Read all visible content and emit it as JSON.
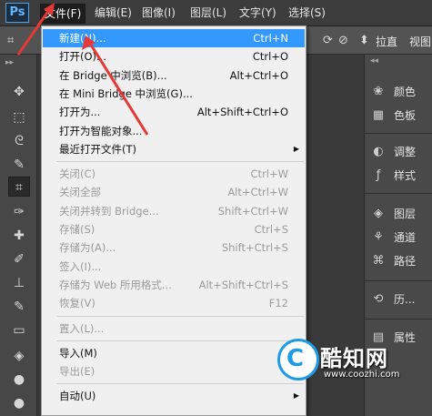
{
  "app": {
    "logo": "Ps"
  },
  "menubar": [
    {
      "label": "文件(F)",
      "active": true
    },
    {
      "label": "编辑(E)"
    },
    {
      "label": "图像(I)"
    },
    {
      "label": "图层(L)"
    },
    {
      "label": "文字(Y)"
    },
    {
      "label": "选择(S)"
    }
  ],
  "options": {
    "pull_label": "拉直",
    "view_label": "视图"
  },
  "tools": [
    {
      "icon": "move-icon",
      "glyph": "✥"
    },
    {
      "icon": "marquee-icon",
      "glyph": "⬚"
    },
    {
      "icon": "lasso-icon",
      "glyph": "ᘓ"
    },
    {
      "icon": "quick-select-icon",
      "glyph": "✎"
    },
    {
      "icon": "crop-icon",
      "glyph": "⌗",
      "selected": true
    },
    {
      "icon": "eyedropper-icon",
      "glyph": "✑"
    },
    {
      "icon": "healing-brush-icon",
      "glyph": "✚"
    },
    {
      "icon": "brush-icon",
      "glyph": "✐"
    },
    {
      "icon": "clone-stamp-icon",
      "glyph": "⊥"
    },
    {
      "icon": "history-brush-icon",
      "glyph": "✎"
    },
    {
      "icon": "eraser-icon",
      "glyph": "▭"
    },
    {
      "icon": "paint-bucket-icon",
      "glyph": "◈"
    },
    {
      "icon": "blur-icon",
      "glyph": "●"
    },
    {
      "icon": "dodge-icon",
      "glyph": "●"
    }
  ],
  "panel": [
    {
      "icon": "color-icon",
      "glyph": "❀",
      "label": "颜色"
    },
    {
      "icon": "swatches-icon",
      "glyph": "▦",
      "label": "色板"
    },
    {
      "icon": "adjustments-icon",
      "glyph": "◐",
      "label": "调整"
    },
    {
      "icon": "styles-icon",
      "glyph": "ƒ",
      "label": "样式"
    },
    {
      "icon": "layers-icon",
      "glyph": "◈",
      "label": "图层"
    },
    {
      "icon": "channels-icon",
      "glyph": "⚘",
      "label": "通道"
    },
    {
      "icon": "paths-icon",
      "glyph": "⌘",
      "label": "路径"
    },
    {
      "icon": "history-icon",
      "glyph": "⟲",
      "label": "历..."
    },
    {
      "icon": "properties-icon",
      "glyph": "▤",
      "label": "属性"
    }
  ],
  "file_menu": [
    {
      "label": "新建(N)...",
      "shortcut": "Ctrl+N",
      "highlighted": true
    },
    {
      "label": "打开(O)...",
      "shortcut": "Ctrl+O"
    },
    {
      "label": "在 Bridge 中浏览(B)...",
      "shortcut": "Alt+Ctrl+O"
    },
    {
      "label": "在 Mini Bridge 中浏览(G)...",
      "shortcut": ""
    },
    {
      "label": "打开为...",
      "shortcut": "Alt+Shift+Ctrl+O"
    },
    {
      "label": "打开为智能对象...",
      "shortcut": ""
    },
    {
      "label": "最近打开文件(T)",
      "shortcut": "",
      "submenu": true
    },
    {
      "separator": true
    },
    {
      "label": "关闭(C)",
      "shortcut": "Ctrl+W",
      "disabled": true
    },
    {
      "label": "关闭全部",
      "shortcut": "Alt+Ctrl+W",
      "disabled": true
    },
    {
      "label": "关闭并转到 Bridge...",
      "shortcut": "Shift+Ctrl+W",
      "disabled": true
    },
    {
      "label": "存储(S)",
      "shortcut": "Ctrl+S",
      "disabled": true
    },
    {
      "label": "存储为(A)...",
      "shortcut": "Shift+Ctrl+S",
      "disabled": true
    },
    {
      "label": "签入(I)...",
      "shortcut": "",
      "disabled": true
    },
    {
      "label": "存储为 Web 所用格式...",
      "shortcut": "Alt+Shift+Ctrl+S",
      "disabled": true
    },
    {
      "label": "恢复(V)",
      "shortcut": "F12",
      "disabled": true
    },
    {
      "separator": true
    },
    {
      "label": "置入(L)...",
      "shortcut": "",
      "disabled": true
    },
    {
      "separator": true
    },
    {
      "label": "导入(M)",
      "shortcut": "",
      "submenu": true
    },
    {
      "label": "导出(E)",
      "shortcut": "",
      "submenu": true,
      "disabled": true
    },
    {
      "separator": true
    },
    {
      "label": "自动(U)",
      "shortcut": "",
      "submenu": true
    }
  ],
  "watermark": {
    "logo_letter": "C",
    "title": "酷知网",
    "url": "www.coozhi.com"
  },
  "colors": {
    "highlight": "#3399ff",
    "arrow": "#e53935",
    "brand": "#1e9ae6"
  }
}
